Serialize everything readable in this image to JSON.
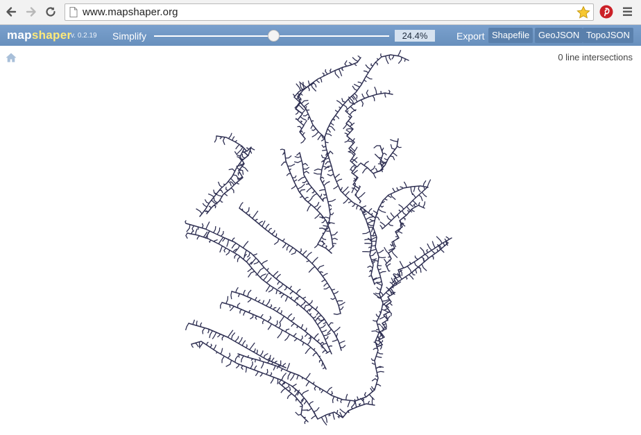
{
  "browser": {
    "url": "www.mapshaper.org",
    "icons": [
      "back-arrow-icon",
      "forward-arrow-icon",
      "reload-icon",
      "page-icon",
      "bookmark-star-icon",
      "pinterest-icon",
      "menu-icon"
    ]
  },
  "app": {
    "logo_part_a": "map",
    "logo_part_b": "shaper",
    "version": "v. 0.2.19",
    "simplify_label": "Simplify",
    "simplify_fraction": 0.51,
    "percent_text": "24.4%",
    "export_label": "Export",
    "export_formats": [
      "Shapefile",
      "GeoJSON",
      "TopoJSON"
    ]
  },
  "map": {
    "intersections_text": "0 line intersections",
    "line_color": "#2e2f52",
    "home_icon": "home-icon"
  },
  "colors": {
    "toolbar": "#6f96c3",
    "button": "#5a80ac",
    "logo_accent": "#ffea7a"
  }
}
